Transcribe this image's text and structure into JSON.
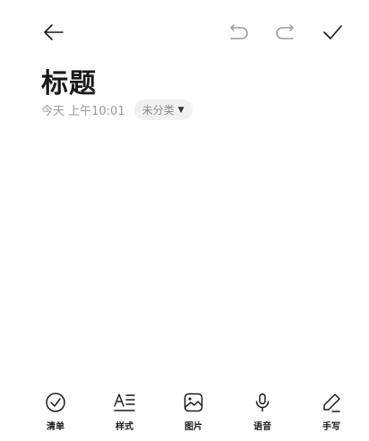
{
  "header": {
    "back_icon": "arrow-left-icon",
    "undo_icon": "undo-icon",
    "redo_icon": "redo-icon",
    "done_icon": "checkmark-icon"
  },
  "note": {
    "title": "标题",
    "date": "今天 上午10:01",
    "category": "未分类"
  },
  "toolbar": {
    "items": [
      {
        "label": "清单",
        "icon": "checklist-icon"
      },
      {
        "label": "样式",
        "icon": "text-style-icon"
      },
      {
        "label": "图片",
        "icon": "image-icon"
      },
      {
        "label": "语音",
        "icon": "microphone-icon"
      },
      {
        "label": "手写",
        "icon": "pen-icon"
      }
    ]
  }
}
